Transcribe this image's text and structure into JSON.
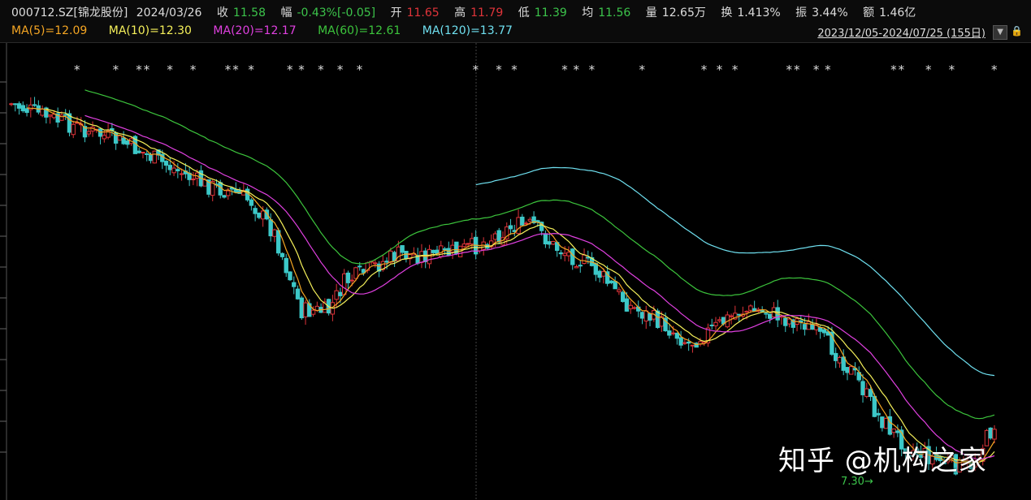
{
  "header": {
    "code_name": "000712.SZ[锦龙股份]",
    "date": "2024/03/26",
    "close_label": "收",
    "close_value": "11.58",
    "change_label": "幅",
    "change_value": "-0.43%[-0.05]",
    "open_label": "开",
    "open_value": "11.65",
    "high_label": "高",
    "high_value": "11.79",
    "low_label": "低",
    "low_value": "11.39",
    "avg_label": "均",
    "avg_value": "11.56",
    "vol_label": "量",
    "vol_value": "12.65万",
    "turnover_label": "换",
    "turnover_value": "1.413%",
    "amplitude_label": "振",
    "amplitude_value": "3.44%",
    "amount_label": "额",
    "amount_value": "1.46亿",
    "range": "2023/12/05-2024/07/25 (155日)"
  },
  "ma_legend": [
    {
      "label": "MA(5)=12.09",
      "color": "#f5a623"
    },
    {
      "label": "MA(10)=12.30",
      "color": "#f5f05a"
    },
    {
      "label": "MA(20)=12.17",
      "color": "#e040e0"
    },
    {
      "label": "MA(60)=12.61",
      "color": "#3cc43c"
    },
    {
      "label": "MA(120)=13.77",
      "color": "#6fe0f0"
    }
  ],
  "colors": {
    "up": "#e0343a",
    "down": "#3cc8c8",
    "text_up": "#e0343a",
    "text_down": "#3cc44b"
  },
  "watermark": "知乎 @机构之家",
  "min_label": "7.30→",
  "chart_data": {
    "type": "candlestick",
    "period": "2023/12/05-2024/07/25",
    "trading_days": 155,
    "low_marker": 7.3,
    "star_marker": "*",
    "star_indices": [
      17,
      27,
      33,
      35,
      41,
      47,
      56,
      58,
      62,
      72,
      75,
      80,
      85,
      90,
      120,
      126,
      130,
      143,
      146,
      150,
      163,
      179,
      183,
      187,
      201,
      203,
      208,
      211,
      228,
      230,
      237,
      243,
      254
    ],
    "ma_series": [
      "MA(5)",
      "MA(10)",
      "MA(20)",
      "MA(60)",
      "MA(120)"
    ]
  }
}
